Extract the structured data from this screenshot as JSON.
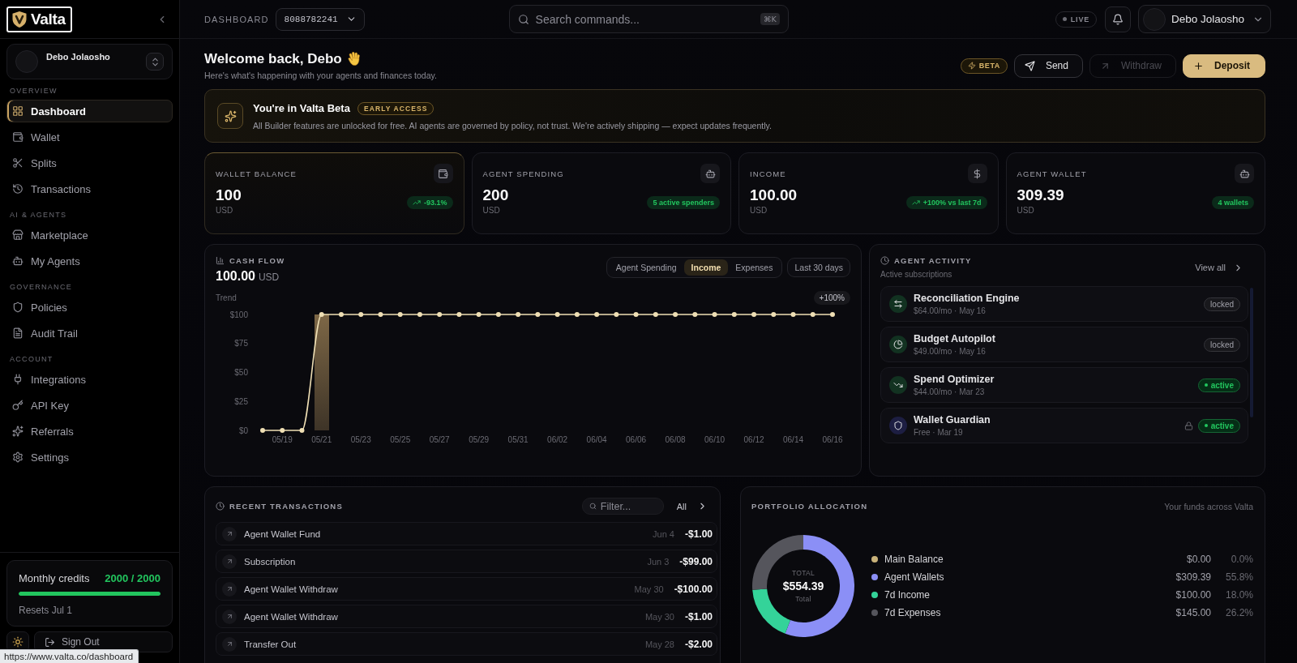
{
  "sidebar": {
    "logo": "Valta",
    "user": {
      "name": "Debo Jolaosho"
    },
    "sections": [
      {
        "label": "OVERVIEW",
        "items": [
          {
            "label": "Dashboard",
            "selected": true
          },
          {
            "label": "Wallet",
            "selected": false
          },
          {
            "label": "Splits",
            "selected": false
          },
          {
            "label": "Transactions",
            "selected": false
          }
        ]
      },
      {
        "label": "AI & AGENTS",
        "items": [
          {
            "label": "Marketplace",
            "selected": false
          },
          {
            "label": "My Agents",
            "selected": false
          }
        ]
      },
      {
        "label": "GOVERNANCE",
        "items": [
          {
            "label": "Policies",
            "selected": false
          },
          {
            "label": "Audit Trail",
            "selected": false
          }
        ]
      },
      {
        "label": "ACCOUNT",
        "items": [
          {
            "label": "Integrations",
            "selected": false
          },
          {
            "label": "API Key",
            "selected": false
          },
          {
            "label": "Referrals",
            "selected": false
          },
          {
            "label": "Settings",
            "selected": false
          }
        ]
      }
    ],
    "credits": {
      "label": "Monthly credits",
      "count": "2000 / 2000",
      "level": 1,
      "reset": "Resets Jul 1"
    },
    "sign_out": "Sign Out"
  },
  "topbar": {
    "page": "DASHBOARD",
    "account": "8088782241",
    "search": {
      "placeholder": "Search commands...",
      "shortcut": "⌘K"
    },
    "live": "LIVE",
    "user": "Debo Jolaosho"
  },
  "header": {
    "title": "Welcome back, Debo",
    "subtitle": "Here's what's happening with your agents and finances today.",
    "beta": "BETA",
    "actions": [
      {
        "label": "Send",
        "kind": "secondary",
        "disabled": false
      },
      {
        "label": "Withdraw",
        "kind": "secondary",
        "disabled": true
      },
      {
        "label": "Deposit",
        "kind": "primary",
        "disabled": false
      }
    ]
  },
  "banner": {
    "title": "You're in Valta Beta",
    "badge": "EARLY ACCESS",
    "text": "All Builder features are unlocked for free. AI agents are governed by policy, not trust. We're actively shipping — expect updates frequently."
  },
  "stats": [
    {
      "label": "WALLET BALANCE",
      "value": "100",
      "unit": "USD",
      "badge": "-93.1%",
      "trend": true,
      "highlighted": true
    },
    {
      "label": "AGENT SPENDING",
      "value": "200",
      "unit": "USD",
      "badge": "5 active spenders",
      "trend": false,
      "highlighted": false
    },
    {
      "label": "INCOME",
      "value": "100.00",
      "unit": "USD",
      "badge": "+100% vs last 7d",
      "trend": true,
      "highlighted": false
    },
    {
      "label": "AGENT WALLET",
      "value": "309.39",
      "unit": "USD",
      "badge": "4 wallets",
      "trend": false,
      "highlighted": false
    }
  ],
  "cash_flow": {
    "title": "CASH FLOW",
    "amount": "100.00",
    "unit": "USD",
    "tabs": [
      {
        "label": "Agent Spending",
        "selected": false
      },
      {
        "label": "Income",
        "selected": true
      },
      {
        "label": "Expenses",
        "selected": false
      }
    ],
    "period": "Last 30 days",
    "change": "+100%",
    "chart_data": {
      "type": "line",
      "categories": [
        null,
        "05/19",
        null,
        "05/21",
        null,
        "05/23",
        null,
        "05/25",
        null,
        "05/27",
        null,
        "05/29",
        null,
        "05/31",
        null,
        "06/02",
        null,
        "06/04",
        null,
        "06/06",
        null,
        "06/08",
        null,
        "06/10",
        null,
        "06/12",
        null,
        "06/14",
        null,
        "06/16"
      ],
      "series": [
        {
          "name": "Trend",
          "color": "#efdfb4",
          "marker": "o",
          "values": [
            0,
            0,
            0,
            100,
            100,
            100,
            100,
            100,
            100,
            100,
            100,
            100,
            100,
            100,
            100,
            100,
            100,
            100,
            100,
            100,
            100,
            100,
            100,
            100,
            100,
            100,
            100,
            100,
            100,
            100
          ]
        }
      ],
      "ylim": [
        0,
        100
      ],
      "yticks": [
        {
          "value": 0,
          "label": "$0"
        },
        {
          "value": 25,
          "label": "$25"
        },
        {
          "value": 50,
          "label": "$50"
        },
        {
          "value": 75,
          "label": "$75"
        },
        {
          "value": 100,
          "label": "$100"
        }
      ]
    }
  },
  "agent_activity": {
    "title": "AGENT ACTIVITY",
    "subtitle": "Active subscriptions",
    "view_all": "View all",
    "items": [
      {
        "name": "Reconciliation Engine",
        "meta": "$64.00/mo · May 16",
        "color": "#123221",
        "status": "locked",
        "active": false,
        "lock": false
      },
      {
        "name": "Budget Autopilot",
        "meta": "$49.00/mo · May 16",
        "color": "#123221",
        "status": "locked",
        "active": false,
        "lock": false
      },
      {
        "name": "Spend Optimizer",
        "meta": "$44.00/mo · Mar 23",
        "color": "#123221",
        "status": "active",
        "active": true,
        "lock": false
      },
      {
        "name": "Wallet Guardian",
        "meta": "Free · Mar 19",
        "color": "#1d1e42",
        "status": "active",
        "active": true,
        "lock": true
      }
    ]
  },
  "transactions": {
    "title": "RECENT TRANSACTIONS",
    "filter": {
      "placeholder": "Filter..."
    },
    "all": "All",
    "rows": [
      {
        "name": "Agent Wallet Fund",
        "date": "Jun 4",
        "amount": "-$1.00"
      },
      {
        "name": "Subscription",
        "date": "Jun 3",
        "amount": "-$99.00"
      },
      {
        "name": "Agent Wallet Withdraw",
        "date": "May 30",
        "amount": "-$100.00"
      },
      {
        "name": "Agent Wallet Withdraw",
        "date": "May 30",
        "amount": "-$1.00"
      },
      {
        "name": "Transfer Out",
        "date": "May 28",
        "amount": "-$2.00"
      }
    ]
  },
  "portfolio": {
    "title": "PORTFOLIO ALLOCATION",
    "subtitle": "Your funds across Valta",
    "total_label": "TOTAL",
    "total": "$554.39",
    "total_caption": "Total",
    "legend": [
      {
        "color": "#c9b27a",
        "amount": "$0.00",
        "percent": "0.0%"
      },
      {
        "color": "#8b8ff6",
        "amount": "$309.39",
        "percent": "55.8%"
      },
      {
        "color": "#34d399",
        "amount": "$100.00",
        "percent": "18.0%"
      },
      {
        "color": "#55555c",
        "amount": "$145.00",
        "percent": "26.2%"
      }
    ],
    "chart_data": {
      "type": "donut",
      "categories": [
        "Main Balance",
        "Agent Wallets",
        "7d Income",
        "7d Expenses"
      ],
      "values": [
        0,
        55.8,
        18.0,
        26.2
      ]
    }
  },
  "browser_status": "https://www.valta.co/dashboard"
}
